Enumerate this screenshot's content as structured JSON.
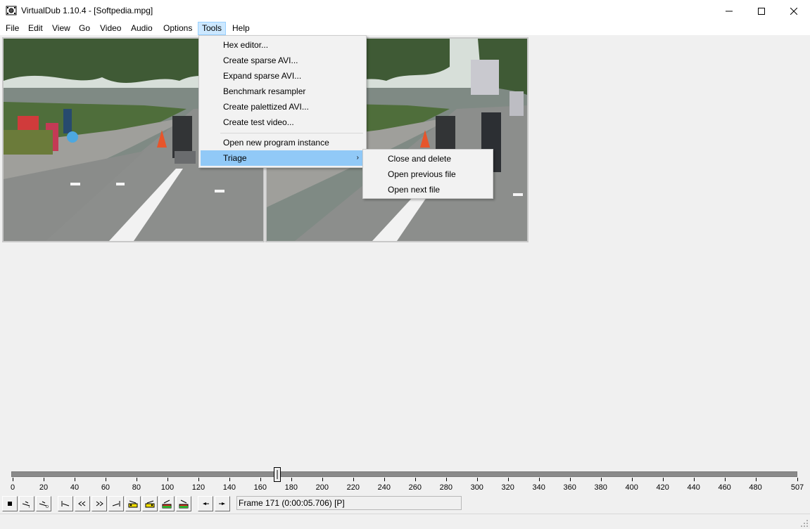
{
  "window": {
    "title": "VirtualDub 1.10.4 - [Softpedia.mpg]",
    "app_icon": "filmstrip-gear-icon",
    "controls": {
      "minimize": "—",
      "maximize": "☐",
      "close": "✕"
    }
  },
  "menubar": {
    "items": [
      "File",
      "Edit",
      "View",
      "Go",
      "Video",
      "Audio",
      "Options",
      "Tools",
      "Help"
    ],
    "active": "Tools"
  },
  "tools_menu": {
    "items": [
      "Hex editor...",
      "Create sparse AVI...",
      "Expand sparse AVI...",
      "Benchmark resampler",
      "Create palettized AVI...",
      "Create test video...",
      "Open new program instance",
      "Triage"
    ],
    "highlighted": "Triage",
    "submenu_arrow": "›"
  },
  "triage_menu": {
    "items": [
      "Close and delete",
      "Open previous file",
      "Open next file"
    ]
  },
  "timeline": {
    "tick_labels": [
      "0",
      "20",
      "40",
      "60",
      "80",
      "100",
      "120",
      "140",
      "160",
      "180",
      "200",
      "220",
      "240",
      "260",
      "280",
      "300",
      "320",
      "340",
      "360",
      "380",
      "400",
      "420",
      "440",
      "460",
      "480",
      "507"
    ],
    "min": 0,
    "max": 507,
    "current_frame": 171
  },
  "toolbar": {
    "buttons": [
      "stop-icon",
      "play-input-icon",
      "play-output-icon",
      "go-start-icon",
      "prev-key-icon",
      "next-key-icon",
      "go-end-icon",
      "key-prev-icon",
      "key-next-icon",
      "mark-in-icon",
      "mark-out-icon",
      "scene-prev-icon",
      "scene-next-icon"
    ],
    "status": "Frame 171 (0:00:05.706) [P]"
  },
  "colors": {
    "menu_highlight": "#91c9f7",
    "menubar_active": "#cce8ff",
    "background": "#f0f0f0"
  }
}
